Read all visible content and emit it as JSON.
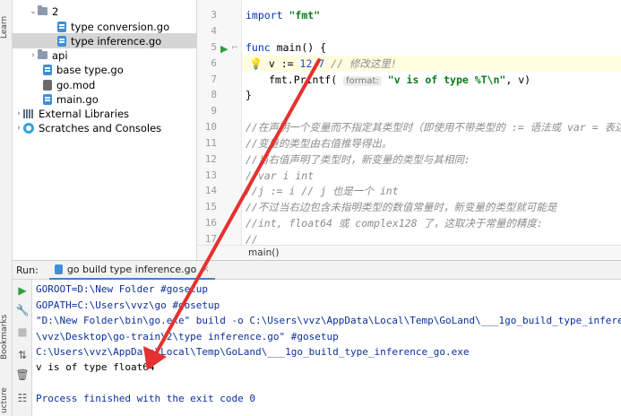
{
  "left_strip": {
    "learn": "Learn",
    "bookmarks": "Bookmarks",
    "structure": "ucture"
  },
  "tree": {
    "items": [
      {
        "label": "2",
        "type": "folder"
      },
      {
        "label": "type conversion.go",
        "type": "go"
      },
      {
        "label": "type inference.go",
        "type": "go",
        "selected": true
      },
      {
        "label": "api",
        "type": "folder"
      },
      {
        "label": "base type.go",
        "type": "go"
      },
      {
        "label": "go.mod",
        "type": "mod"
      },
      {
        "label": "main.go",
        "type": "go"
      },
      {
        "label": "External Libraries",
        "type": "lib"
      },
      {
        "label": "Scratches and Consoles",
        "type": "scratch"
      }
    ]
  },
  "editor": {
    "line_numbers": [
      "3",
      "4",
      "5",
      "6",
      "7",
      "8",
      "9",
      "10",
      "11",
      "12",
      "13",
      "14",
      "15",
      "16",
      "17"
    ],
    "lines": {
      "l3_kw": "import",
      "l3_str": "\"fmt\"",
      "l5_kw": "func",
      "l5_rest": " main() {",
      "l6_code": "v := ",
      "l6_num": "12.7",
      "l6_cmt": " // 修改这里!",
      "l7_code": "fmt.Printf(",
      "l7_hint": "format:",
      "l7_str": "\"v is of type %T\\n\"",
      "l7_rest": ", v)",
      "l8": "}",
      "l10": "//在声明一个变量而不指定其类型时（即使用不带类型的 := 语法或 var = 表达式语法）",
      "l11": "//变量的类型由右值推导得出。",
      "l12": "//当右值声明了类型时，新变量的类型与其相同:",
      "l13": "//var i int",
      "l14": "//j := i // j 也是一个 int",
      "l15": "//不过当右边包含未指明类型的数值常量时，新变量的类型就可能是",
      "l16": "//int, float64 或 complex128 了，这取决于常量的精度:",
      "l17": "//"
    },
    "breadcrumb": "main()"
  },
  "run": {
    "label": "Run:",
    "tab": "go build type inference.go",
    "output": [
      {
        "text": "GOROOT=D:\\New Folder #gosetup",
        "kind": "sys"
      },
      {
        "text": "GOPATH=C:\\Users\\vvz\\go #gosetup",
        "kind": "sys"
      },
      {
        "text": "\"D:\\New Folder\\bin\\go.exe\" build -o C:\\Users\\vvz\\AppData\\Local\\Temp\\GoLand\\___1go_build_type_inferenc",
        "kind": "sys"
      },
      {
        "text": "\\vvz\\Desktop\\go-train\\2\\type inference.go\" #gosetup",
        "kind": "sys"
      },
      {
        "text": "C:\\Users\\vvz\\AppData\\Local\\Temp\\GoLand\\___1go_build_type_inference_go.exe",
        "kind": "sys"
      },
      {
        "text": "v is of type float64",
        "kind": "plain"
      },
      {
        "text": "",
        "kind": "plain"
      },
      {
        "text": "Process finished with the exit code 0",
        "kind": "sys"
      }
    ]
  },
  "colors": {
    "selection": "#d5d5d5",
    "arrow": "#e53030",
    "keyword": "#0033b3",
    "string": "#067d17"
  }
}
